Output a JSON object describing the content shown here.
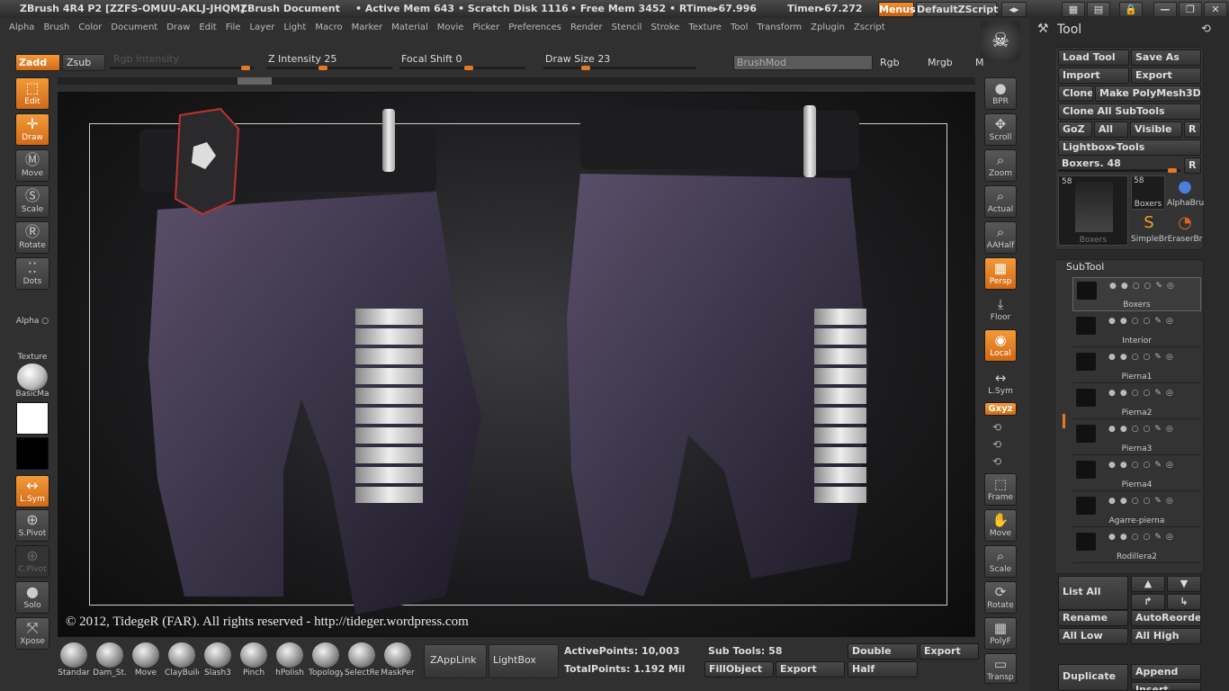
{
  "titlebar": {
    "app": "ZBrush 4R4 P2 [ZZFS-OMUU-AKLJ-JHQM]",
    "document": "ZBrush Document",
    "active_mem": "• Active Mem 643",
    "scratch_disk": "• Scratch Disk 1116",
    "free_mem": "• Free Mem 3452",
    "rtime": "• RTime▸67.996",
    "timer": "Timer▸67.272",
    "menus_btn": "Menus",
    "default_zscript": "DefaultZScript"
  },
  "menubar": [
    "Alpha",
    "Brush",
    "Color",
    "Document",
    "Draw",
    "Edit",
    "File",
    "Layer",
    "Light",
    "Macro",
    "Marker",
    "Material",
    "Movie",
    "Picker",
    "Preferences",
    "Render",
    "Stencil",
    "Stroke",
    "Texture",
    "Tool",
    "Transform",
    "Zplugin",
    "Zscript"
  ],
  "drawbar": {
    "zadd": "Zadd",
    "zsub": "Zsub",
    "rgb_intensity": "Rgb Intensity",
    "z_intensity_label": "Z Intensity",
    "z_intensity": 25,
    "focal_shift_label": "Focal Shift",
    "focal_shift": 0,
    "draw_size_label": "Draw Size",
    "draw_size": 23,
    "brushmod": "BrushMod",
    "rgb": "Rgb",
    "mrgb": "Mrgb",
    "m": "M"
  },
  "left_shelf": {
    "edit": "Edit",
    "draw": "Draw",
    "move": "Move",
    "scale": "Scale",
    "rotate": "Rotate",
    "dots": "Dots",
    "alpha": "Alpha",
    "texture": "Texture",
    "material": "BasicMa",
    "lsym": "L.Sym",
    "spivot": "S.Pivot",
    "cpivot": "C.Pivot",
    "solo": "Solo",
    "xpose": "Xpose"
  },
  "right_shelf": {
    "bpr": "BPR",
    "scroll": "Scroll",
    "zoom": "Zoom",
    "actual": "Actual",
    "aahalf": "AAHalf",
    "persp": "Persp",
    "floor": "Floor",
    "local": "Local",
    "lsym": "L.Sym",
    "xyz": "Gxyz",
    "frame": "Frame",
    "move": "Move",
    "scale": "Scale",
    "rotate": "Rotate",
    "polyf": "PolyF",
    "transp": "Transp"
  },
  "canvas": {
    "copyright": "© 2012, TidegeR (FAR). All rights reserved - http://tideger.wordpress.com"
  },
  "bottom": {
    "brushes": [
      "Standar",
      "Dam_St.",
      "Move",
      "ClayBuilc",
      "Slash3",
      "Pinch",
      "hPolish",
      "Topology",
      "SelectRe",
      "MaskPer"
    ],
    "zapplink": "ZAppLink",
    "lightbox": "LightBox",
    "active_points": "ActivePoints: 10,003",
    "total_points": "TotalPoints: 1.192 Mil",
    "sub_tools": "Sub Tools: 58",
    "fillobject": "FillObject",
    "export1": "Export",
    "double": "Double",
    "export2": "Export",
    "half": "Half"
  },
  "tool_panel": {
    "title": "Tool",
    "load_tool": "Load Tool",
    "save_as": "Save As",
    "import": "Import",
    "export": "Export",
    "clone": "Clone",
    "make_polymesh": "Make PolyMesh3D",
    "clone_all": "Clone All SubTools",
    "goz": "GoZ",
    "all": "All",
    "visible": "Visible",
    "r": "R",
    "lightbox_tools": "Lightbox▸Tools",
    "boxers_label": "Boxers. 48",
    "thumb_count1": "58",
    "thumb_count2": "58",
    "thumb_main": "Boxers",
    "thumb_boxers": "Boxers",
    "thumb_alpha": "AlphaBru",
    "thumb_simple": "SimpleBr",
    "thumb_eraser": "EraserBr",
    "subtool_title": "SubTool",
    "subtools": [
      "Boxers",
      "Interior",
      "Pierna1",
      "Pierna2",
      "Pierna3",
      "Pierna4",
      "Agarre-pierna",
      "Rodillera2"
    ],
    "list_all": "List All",
    "rename": "Rename",
    "autoreorder": "AutoReorder",
    "all_low": "All Low",
    "all_high": "All High",
    "duplicate": "Duplicate",
    "append": "Append",
    "insert": "Insert"
  }
}
